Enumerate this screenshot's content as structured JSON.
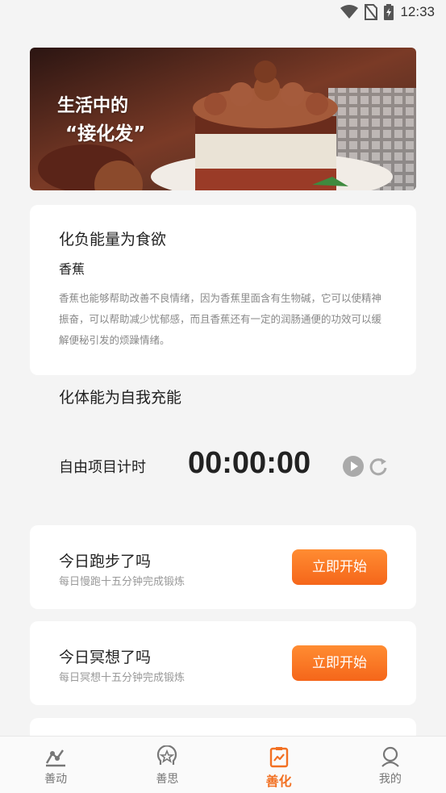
{
  "status": {
    "time": "12:33"
  },
  "banner": {
    "line1": "生活中的",
    "line2": "“接化发”"
  },
  "info_card": {
    "title": "化负能量为食欲",
    "subtitle": "香蕉",
    "description": "香蕉也能够帮助改善不良情绪，因为香蕉里面含有生物碱，它可以使精神振奋，可以帮助减少忧郁感，而且香蕉还有一定的润肠通便的功效可以缓解便秘引发的烦躁情绪。"
  },
  "section": {
    "title": "化体能为自我充能"
  },
  "timer": {
    "label": "自由项目计时",
    "value": "00:00:00"
  },
  "tasks": [
    {
      "title": "今日跑步了吗",
      "subtitle": "每日慢跑十五分钟完成锻炼",
      "button": "立即开始"
    },
    {
      "title": "今日冥想了吗",
      "subtitle": "每日冥想十五分钟完成锻炼",
      "button": "立即开始"
    }
  ],
  "tabbar": {
    "items": [
      {
        "label": "善动",
        "icon": "activity-chart-icon",
        "active": false
      },
      {
        "label": "善思",
        "icon": "star-head-icon",
        "active": false
      },
      {
        "label": "善化",
        "icon": "clipboard-chart-icon",
        "active": true
      },
      {
        "label": "我的",
        "icon": "person-icon",
        "active": false
      }
    ]
  },
  "colors": {
    "accent": "#f27022",
    "button": "#f5661a",
    "background": "#f4f4f4"
  }
}
